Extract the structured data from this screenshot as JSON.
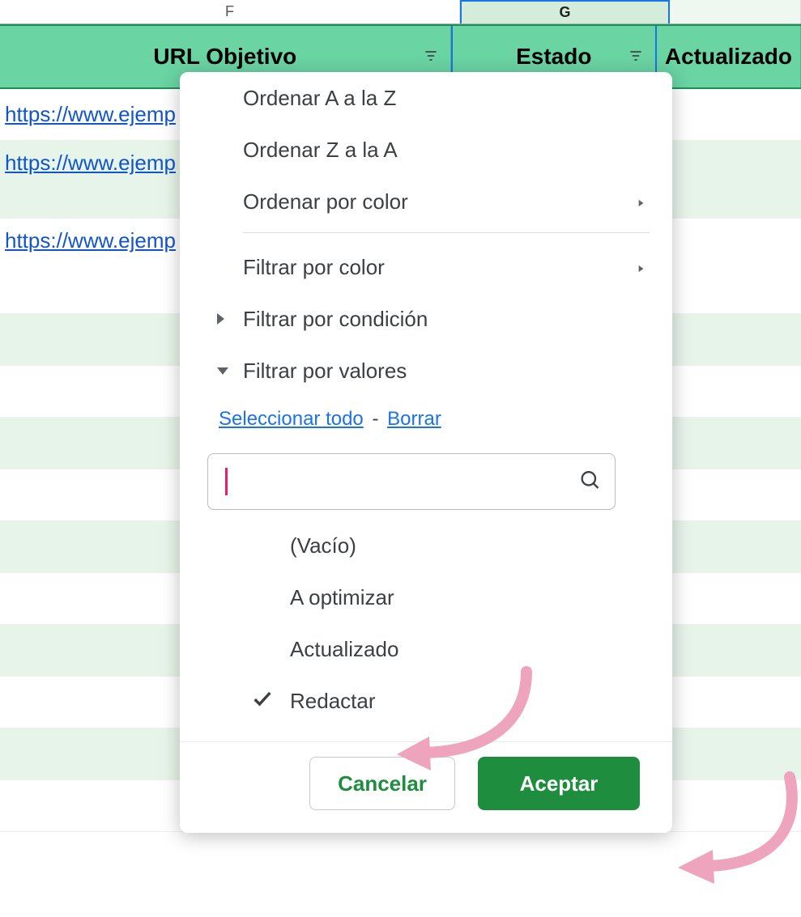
{
  "columns": {
    "f_letter": "F",
    "g_letter": "G",
    "h_letter": "",
    "f_header": "URL Objetivo",
    "g_header": "Estado",
    "h_header": "Actualizado"
  },
  "rows": [
    {
      "url": "https://www.ejemp"
    },
    {
      "url": "https://www.ejemp"
    },
    {
      "url": "https://www.ejemp"
    }
  ],
  "menu": {
    "sort_az": "Ordenar A a la Z",
    "sort_za": "Ordenar Z a la A",
    "sort_color": "Ordenar por color",
    "filter_color": "Filtrar por color",
    "filter_cond": "Filtrar por condición",
    "filter_values": "Filtrar por valores",
    "select_all": "Seleccionar todo",
    "clear": "Borrar",
    "dash": "-",
    "search_value": "",
    "values": [
      {
        "label": "(Vacío)",
        "checked": false
      },
      {
        "label": "A optimizar",
        "checked": false
      },
      {
        "label": "Actualizado",
        "checked": false
      },
      {
        "label": "Redactar",
        "checked": true
      }
    ],
    "cancel": "Cancelar",
    "ok": "Aceptar"
  }
}
